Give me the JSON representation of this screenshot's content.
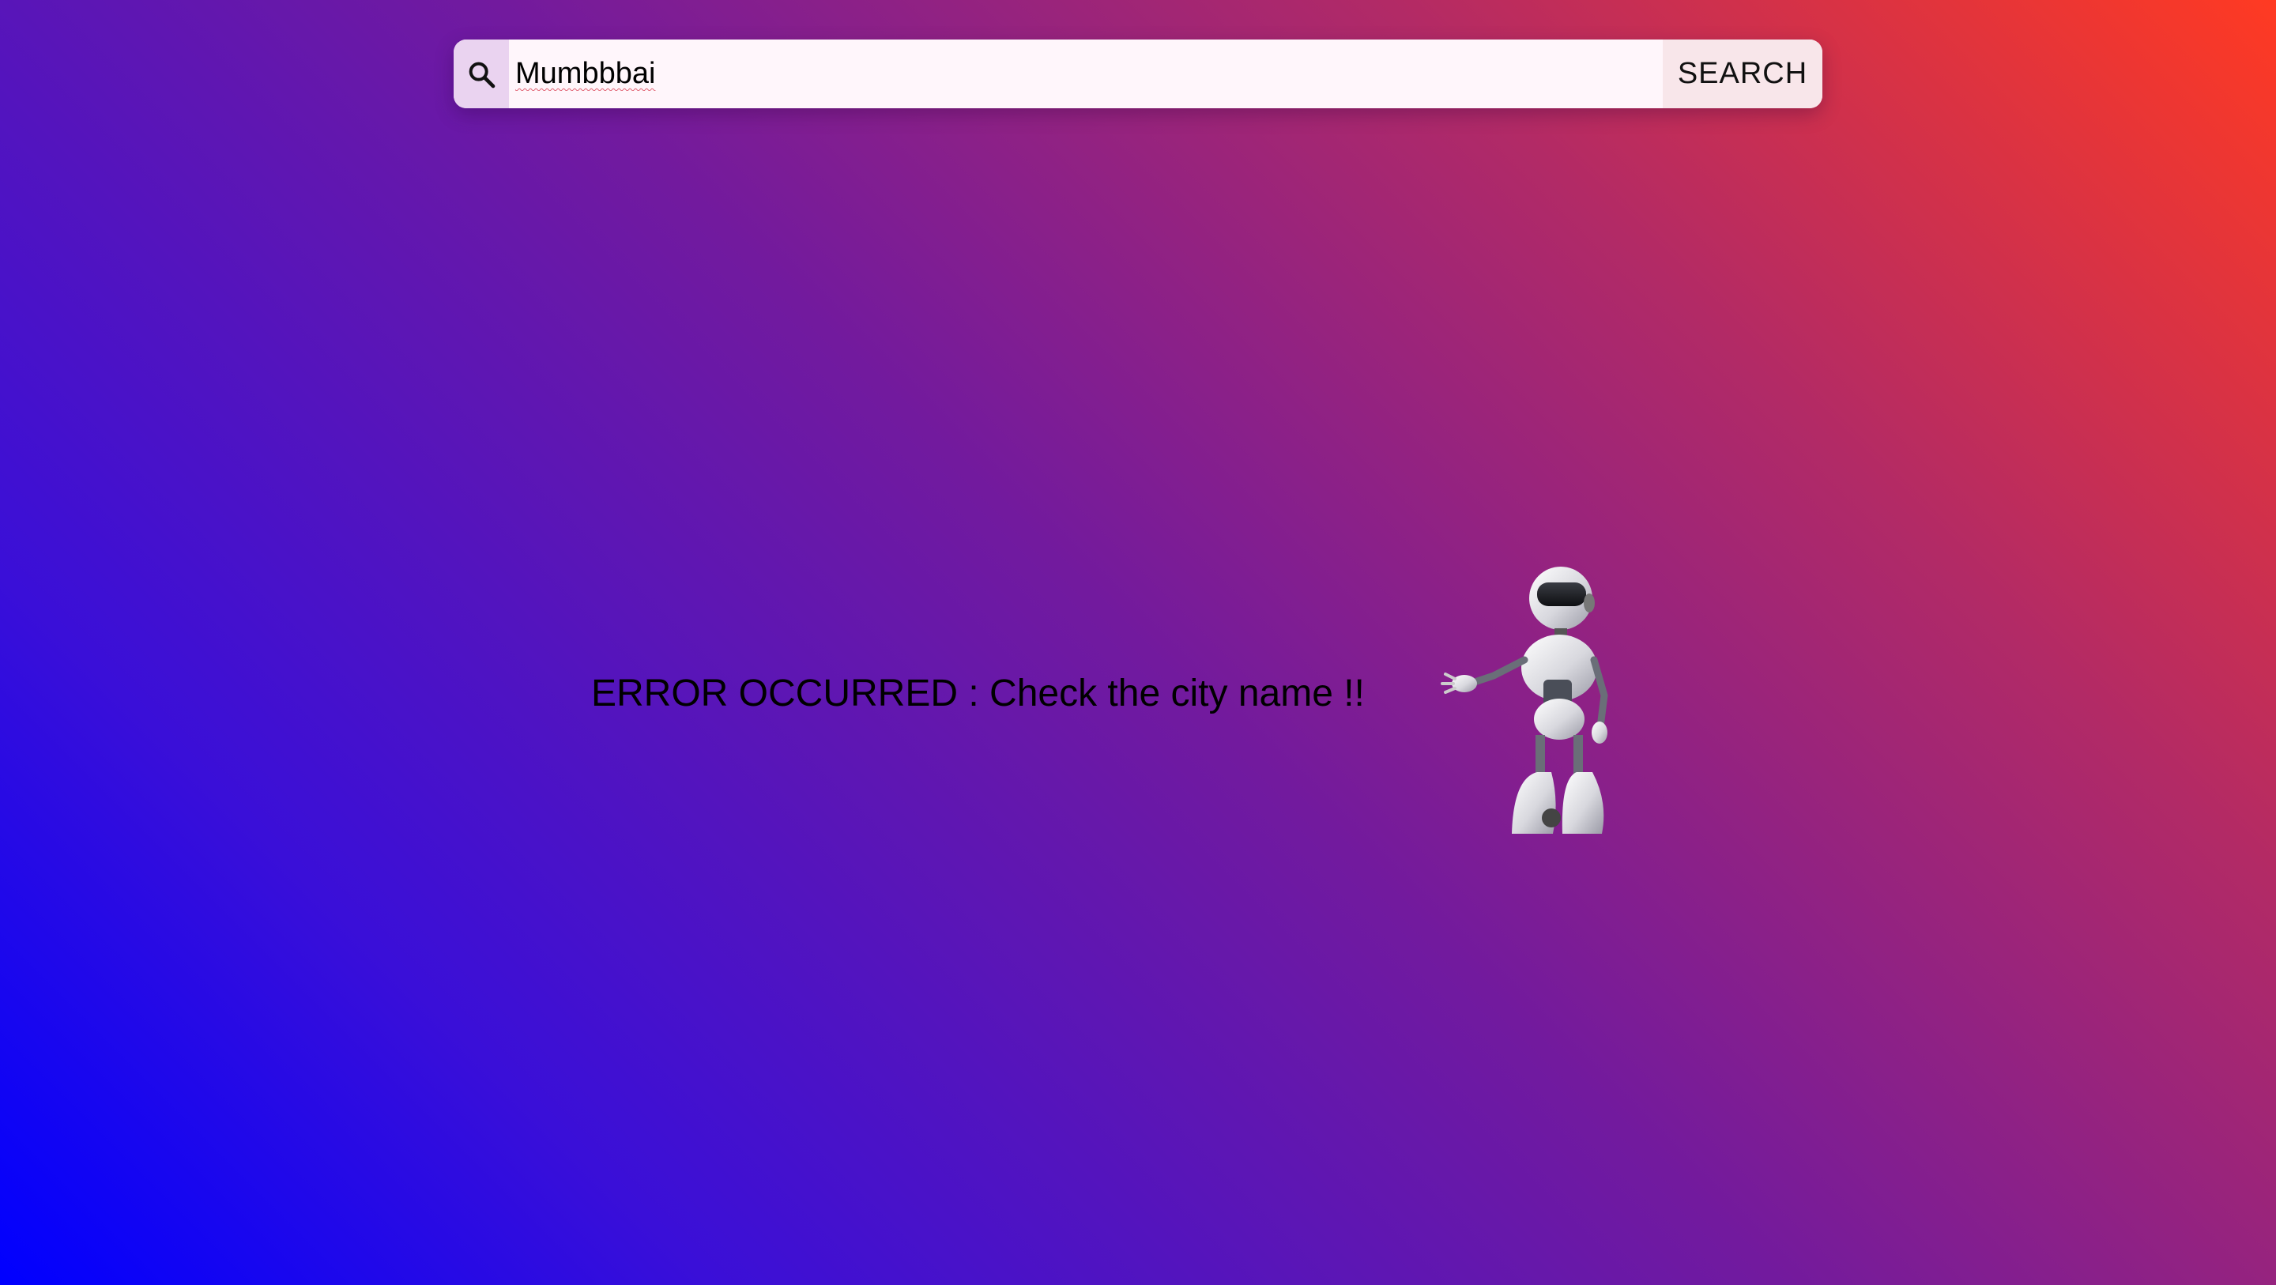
{
  "search": {
    "icon": "search-icon",
    "value": "Mumbbbai",
    "button_label": "SEARCH"
  },
  "error": {
    "message": "ERROR OCCURRED : Check the city name !!"
  },
  "illustration": {
    "name": "robot-illustration"
  },
  "colors": {
    "gradient_start": "#0000ff",
    "gradient_mid": "#721a9e",
    "gradient_end": "#ff3a22"
  }
}
